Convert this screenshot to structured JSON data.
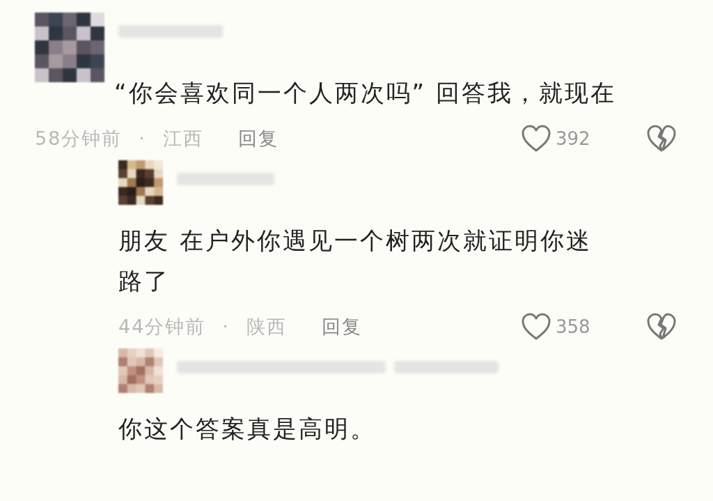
{
  "comments": [
    {
      "text": "“你会喜欢同一个人两次吗” 回答我，就现在",
      "time": "58分钟前",
      "separator": "·",
      "location": "江西",
      "reply": "回复",
      "likes": "392",
      "replies": [
        {
          "text": "朋友 在户外你遇见一个树两次就证明你迷路了",
          "time": "44分钟前",
          "separator": "·",
          "location": "陕西",
          "reply": "回复",
          "likes": "358"
        },
        {
          "text": "你这个答案真是高明。"
        }
      ]
    }
  ]
}
